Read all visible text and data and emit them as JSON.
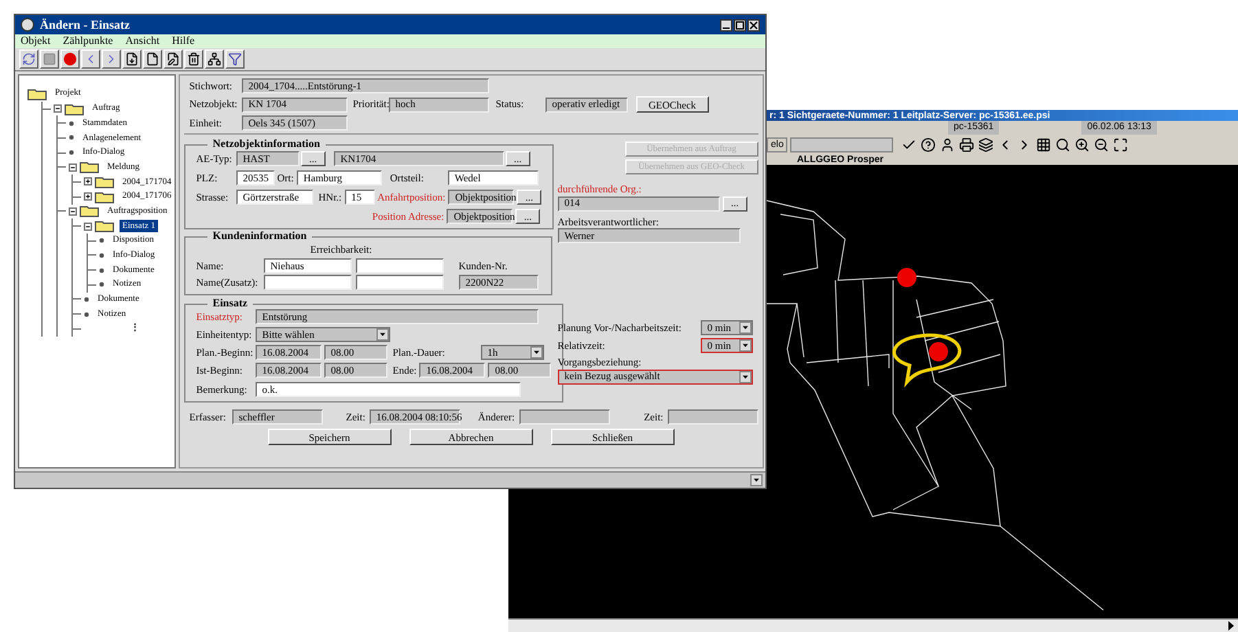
{
  "window": {
    "title": "Ändern - Einsatz"
  },
  "menu": [
    {
      "label": "Objekt"
    },
    {
      "label": "Zählpunkte"
    },
    {
      "label": "Ansicht"
    },
    {
      "label": "Hilfe"
    }
  ],
  "tree": [
    {
      "label": "Projekt",
      "kind": "folder",
      "selected": false,
      "children": [
        {
          "label": "Auftrag",
          "kind": "folder",
          "selected": false,
          "expanded": true,
          "children": [
            {
              "label": "Stammdaten",
              "kind": "leaf",
              "selected": false
            },
            {
              "label": "Anlagenelement",
              "kind": "leaf",
              "selected": false
            },
            {
              "label": "Info-Dialog",
              "kind": "leaf",
              "selected": false
            },
            {
              "label": "Meldung",
              "kind": "folder",
              "selected": false,
              "expanded": true,
              "children": [
                {
                  "label": "2004_171704",
                  "kind": "folder",
                  "selected": false,
                  "expanded": false
                },
                {
                  "label": "2004_171706",
                  "kind": "folder",
                  "selected": false,
                  "expanded": false
                }
              ]
            },
            {
              "label": "Auftragsposition",
              "kind": "folder",
              "selected": false,
              "expanded": true,
              "children": [
                {
                  "label": "Einsatz 1",
                  "kind": "folder",
                  "selected": true,
                  "expanded": true,
                  "children": [
                    {
                      "label": "Disposition",
                      "kind": "leaf",
                      "selected": false
                    },
                    {
                      "label": "Info-Dialog",
                      "kind": "leaf",
                      "selected": false
                    },
                    {
                      "label": "Dokumente",
                      "kind": "leaf",
                      "selected": false
                    },
                    {
                      "label": "Notizen",
                      "kind": "leaf",
                      "selected": false
                    }
                  ]
                },
                {
                  "label": "Dokumente",
                  "kind": "leaf",
                  "selected": false
                },
                {
                  "label": "Notizen",
                  "kind": "leaf",
                  "selected": false
                },
                {
                  "label": "⋮",
                  "kind": "more",
                  "selected": false
                }
              ]
            }
          ]
        }
      ]
    }
  ],
  "header": {
    "stichwort": {
      "label": "Stichwort:",
      "value": "2004_1704.....Entstörung-1"
    },
    "netzobjekt": {
      "label": "Netzobjekt:",
      "value": "KN 1704"
    },
    "prioritaet": {
      "label": "Priorität:",
      "value": "hoch"
    },
    "status": {
      "label": "Status:",
      "value": "operativ erledigt"
    },
    "geocheck": "GEOCheck",
    "einheit": {
      "label": "Einheit:",
      "value": "Oels 345 (1507)"
    }
  },
  "netzobjektinfo": {
    "title": "Netzobjektinformation",
    "ae_typ": {
      "label": "AE-Typ:",
      "value": "HAST",
      "editable": false,
      "button": "..."
    },
    "netzobjekt": {
      "value": "KN1704",
      "editable": false,
      "button": "..."
    },
    "plz": {
      "label": "PLZ:",
      "value": "20535",
      "editable": true
    },
    "ort": {
      "label": "Ort:",
      "value": "Hamburg",
      "editable": true
    },
    "ortsteil": {
      "label": "Ortsteil:",
      "value": "Wedel",
      "editable": true
    },
    "strasse": {
      "label": "Strasse:",
      "value": "Görtzerstraße",
      "editable": true
    },
    "hnr": {
      "label": "HNr.:",
      "value": "15",
      "editable": true
    },
    "anfahrtposition": {
      "label": "Anfahrtposition:",
      "value": "Objektposition",
      "required": true,
      "editable": false,
      "button": "..."
    },
    "position_adresse": {
      "label": "Position Adresse:",
      "value": "Objektposition",
      "required": true,
      "editable": false,
      "button": "..."
    }
  },
  "uebernehmen_buttons": [
    {
      "label": "Übernehmen aus Auftrag",
      "disabled": true
    },
    {
      "label": "Übernehmen aus GEO-Check",
      "disabled": true
    }
  ],
  "org": {
    "label": "durchführende Org.:",
    "value": "014",
    "required": true,
    "button": "..."
  },
  "verantwortlicher": {
    "label": "Arbeitsverantwortlicher:",
    "value": "Werner"
  },
  "kundeninfo": {
    "title": "Kundeninformation",
    "erreichbarkeit": "Erreichbarkeit:",
    "kunden_nr": {
      "label": "Kunden-Nr.",
      "value": "2200N22"
    },
    "rows": [
      {
        "label": "Name:",
        "value": "Niehaus"
      },
      {
        "label": "Name(Zusatz):"
      }
    ]
  },
  "einsatz": {
    "title": "Einsatz",
    "einsatztyp": {
      "label": "Einsatztyp:",
      "value": "Entstörung",
      "required": true
    },
    "einheitentyp": {
      "label": "Einheitentyp:",
      "value": "Bitte wählen"
    },
    "plan_beginn": {
      "label": "Plan.-Beginn:",
      "date": "16.08.2004",
      "time": "08.00"
    },
    "plan_dauer": {
      "label": "Plan.-Dauer:",
      "value": "1h"
    },
    "ist_beginn": {
      "label": "Ist-Beginn:",
      "date": "16.08.2004",
      "time": "08.00"
    },
    "ende": {
      "label": "Ende:",
      "date": "16.08.2004",
      "time": "08.00"
    },
    "bemerkung": {
      "label": "Bemerkung:",
      "value": "o.k."
    }
  },
  "planung": {
    "label": "Planung Vor-/Nacharbeitszeit:",
    "value": "0 min",
    "highlighted": false
  },
  "relativzeit": {
    "label": "Relativzeit:",
    "value": "0 min",
    "highlighted": true
  },
  "vorgangsbeziehung": {
    "label": "Vorgangsbeziehung:",
    "value": "kein Bezug ausgewählt",
    "highlighted": true
  },
  "footer": {
    "erfasser": {
      "label": "Erfasser:",
      "value": "scheffler"
    },
    "zeit": {
      "label": "Zeit:",
      "value": "16.08.2004  08:10:56"
    },
    "aenderer": {
      "label": "Änderer:"
    },
    "zeit2": {
      "label": "Zeit:"
    }
  },
  "buttons": [
    {
      "label": "Speichern"
    },
    {
      "label": "Abbrechen"
    },
    {
      "label": "Schließen"
    }
  ],
  "map_window": {
    "title": "r: 1   Sichtgeraete-Nummer: 1   Leitplatz-Server: pc-15361.ee.psi",
    "host": "pc-15361",
    "datetime": "06.02.06 13:13",
    "toolbar_label": "elo",
    "map_title": "ALLGGEO Prosper"
  }
}
